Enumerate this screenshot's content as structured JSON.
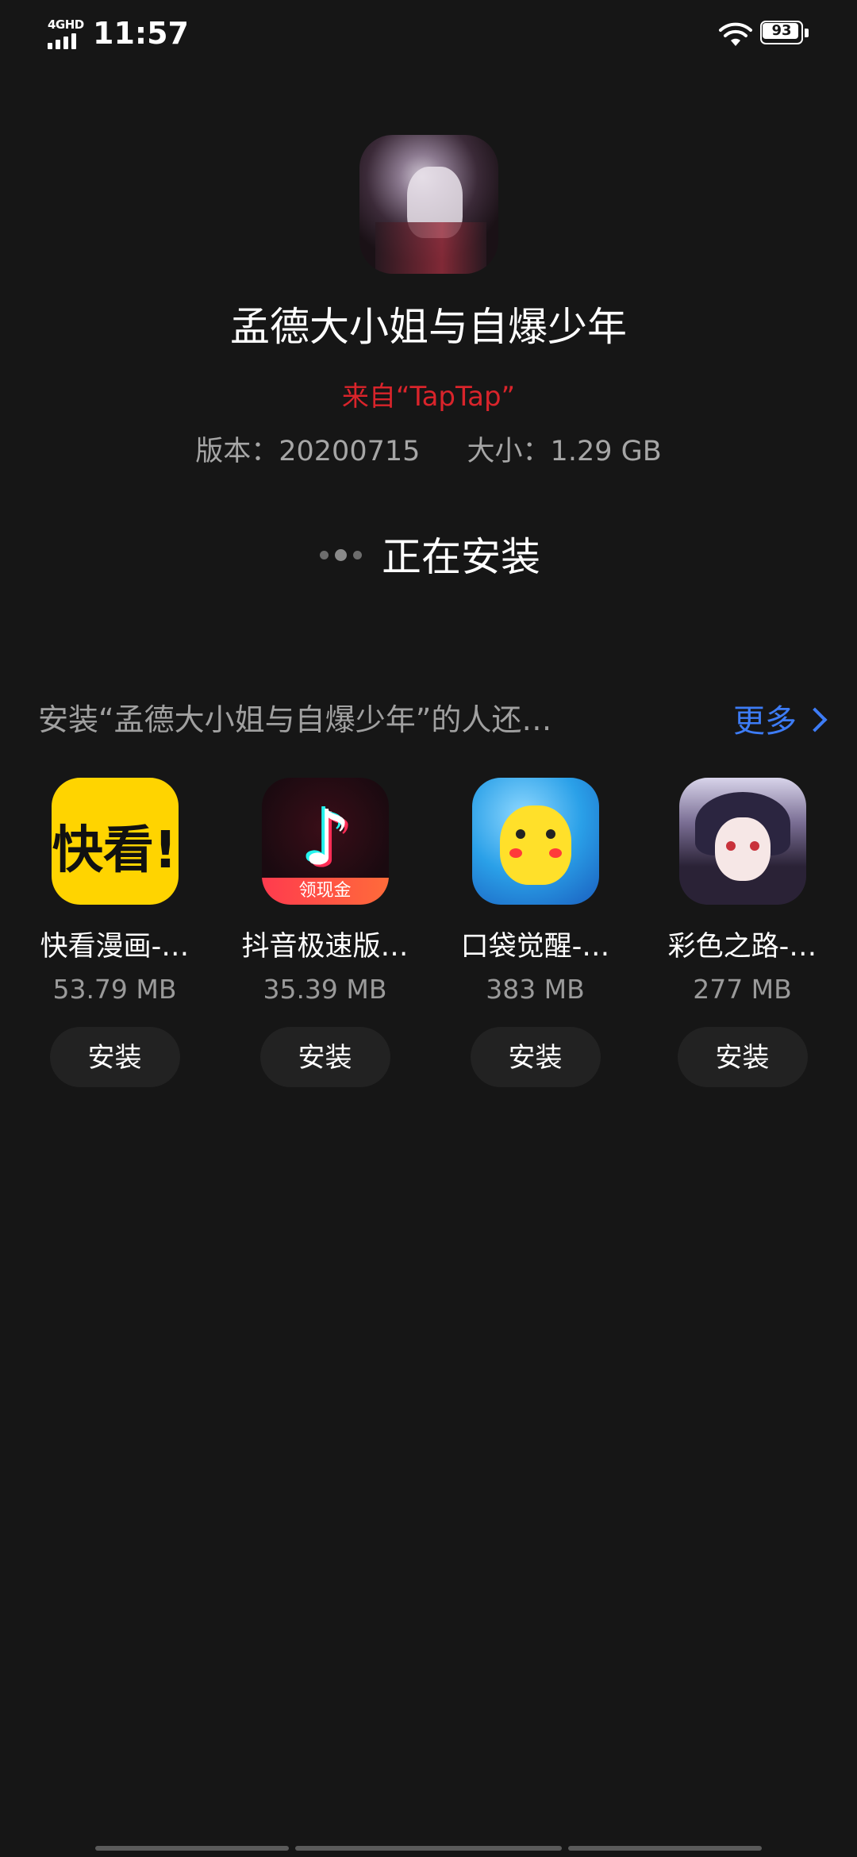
{
  "status_bar": {
    "network": "4GHD",
    "time": "11:57",
    "battery": "93"
  },
  "app": {
    "title": "孟德大小姐与自爆少年",
    "source": "来自“TapTap”",
    "version": "版本：20200715",
    "size": "大小：1.29 GB",
    "status": "正在安装"
  },
  "recommendations": {
    "title": "安装“孟德大小姐与自爆少年”的人还…",
    "more_label": "更多",
    "items": [
      {
        "name": "快看漫画-…",
        "size": "53.79 MB",
        "button": "安装",
        "icon": "kuaikan-icon",
        "icon_text": "快看!"
      },
      {
        "name": "抖音极速版…",
        "size": "35.39 MB",
        "button": "安装",
        "icon": "douyin-icon",
        "icon_text": "领现金"
      },
      {
        "name": "口袋觉醒-…",
        "size": "383 MB",
        "button": "安装",
        "icon": "pokemon-icon"
      },
      {
        "name": "彩色之路-…",
        "size": "277 MB",
        "button": "安装",
        "icon": "caise-icon"
      }
    ]
  },
  "colors": {
    "background": "#161616",
    "source_red": "#d9242b",
    "link_blue": "#3d7cf6"
  }
}
